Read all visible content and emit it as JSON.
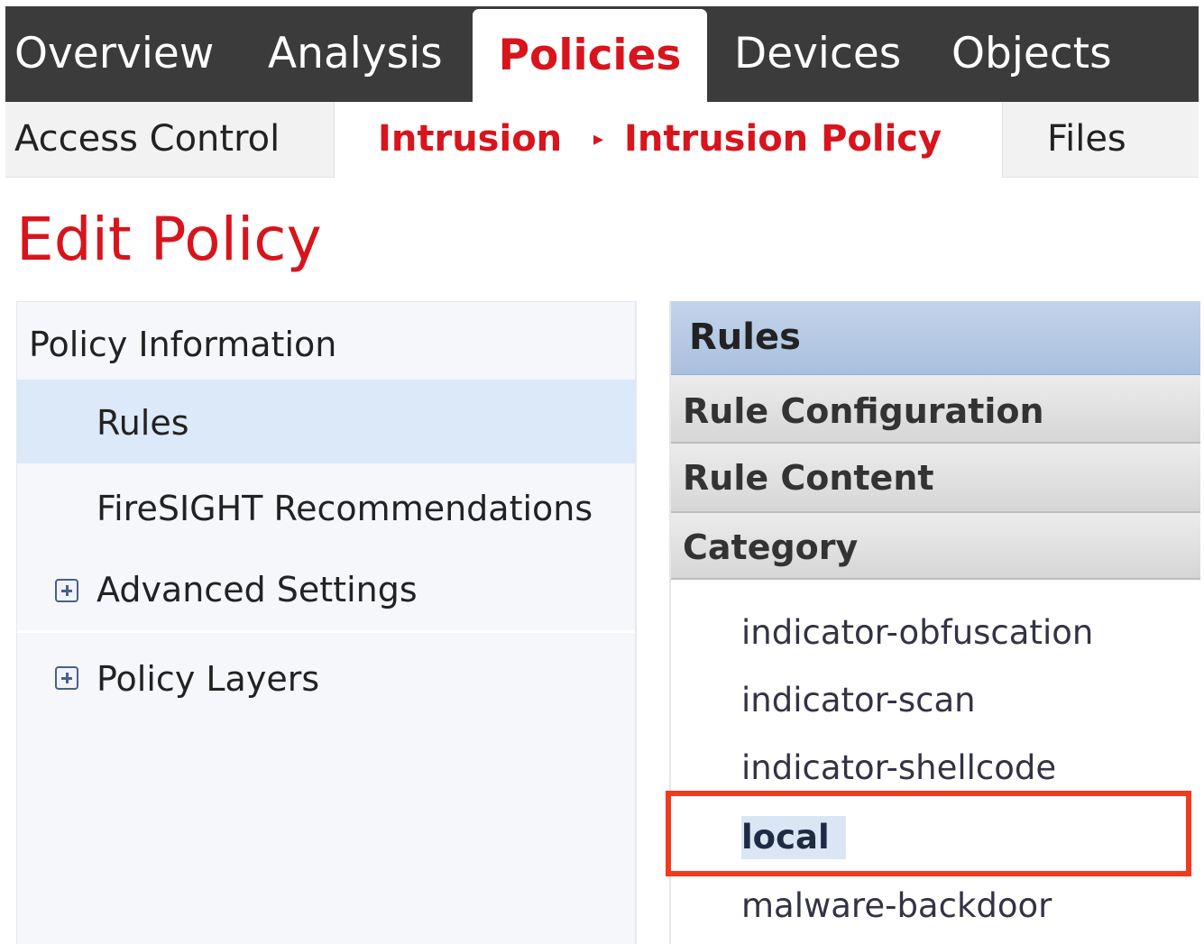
{
  "top_nav": {
    "tabs": [
      {
        "label": "Overview"
      },
      {
        "label": "Analysis"
      },
      {
        "label": "Policies"
      },
      {
        "label": "Devices"
      },
      {
        "label": "Objects"
      }
    ],
    "active_tab": "Policies"
  },
  "sub_nav": {
    "access_control": "Access Control",
    "breadcrumb": [
      "Intrusion",
      "Intrusion Policy"
    ],
    "breadcrumb_separator": "▸",
    "files": "Files"
  },
  "page": {
    "title": "Edit Policy"
  },
  "left_panel": {
    "items": [
      {
        "label": "Policy Information"
      },
      {
        "label": "Rules",
        "selected": true
      },
      {
        "label": "FireSIGHT Recommendations"
      },
      {
        "label": "Advanced Settings",
        "icon": "plus-expand-icon"
      },
      {
        "label": "Policy Layers",
        "icon": "plus-expand-icon"
      }
    ]
  },
  "right_panel": {
    "header": "Rules",
    "sections": [
      "Rule Configuration",
      "Rule Content",
      "Category"
    ],
    "categories": [
      {
        "label": "indicator-obfuscation"
      },
      {
        "label": "indicator-scan"
      },
      {
        "label": "indicator-shellcode"
      },
      {
        "label": "local",
        "selected": true
      },
      {
        "label": "malware-backdoor"
      }
    ]
  },
  "colors": {
    "brand_red": "#d8141c",
    "nav_dark": "#3b3b3b",
    "highlight_box": "#f23a1f",
    "rules_header_blue": "#b4c8e4",
    "selected_row": "#dce9f8"
  }
}
